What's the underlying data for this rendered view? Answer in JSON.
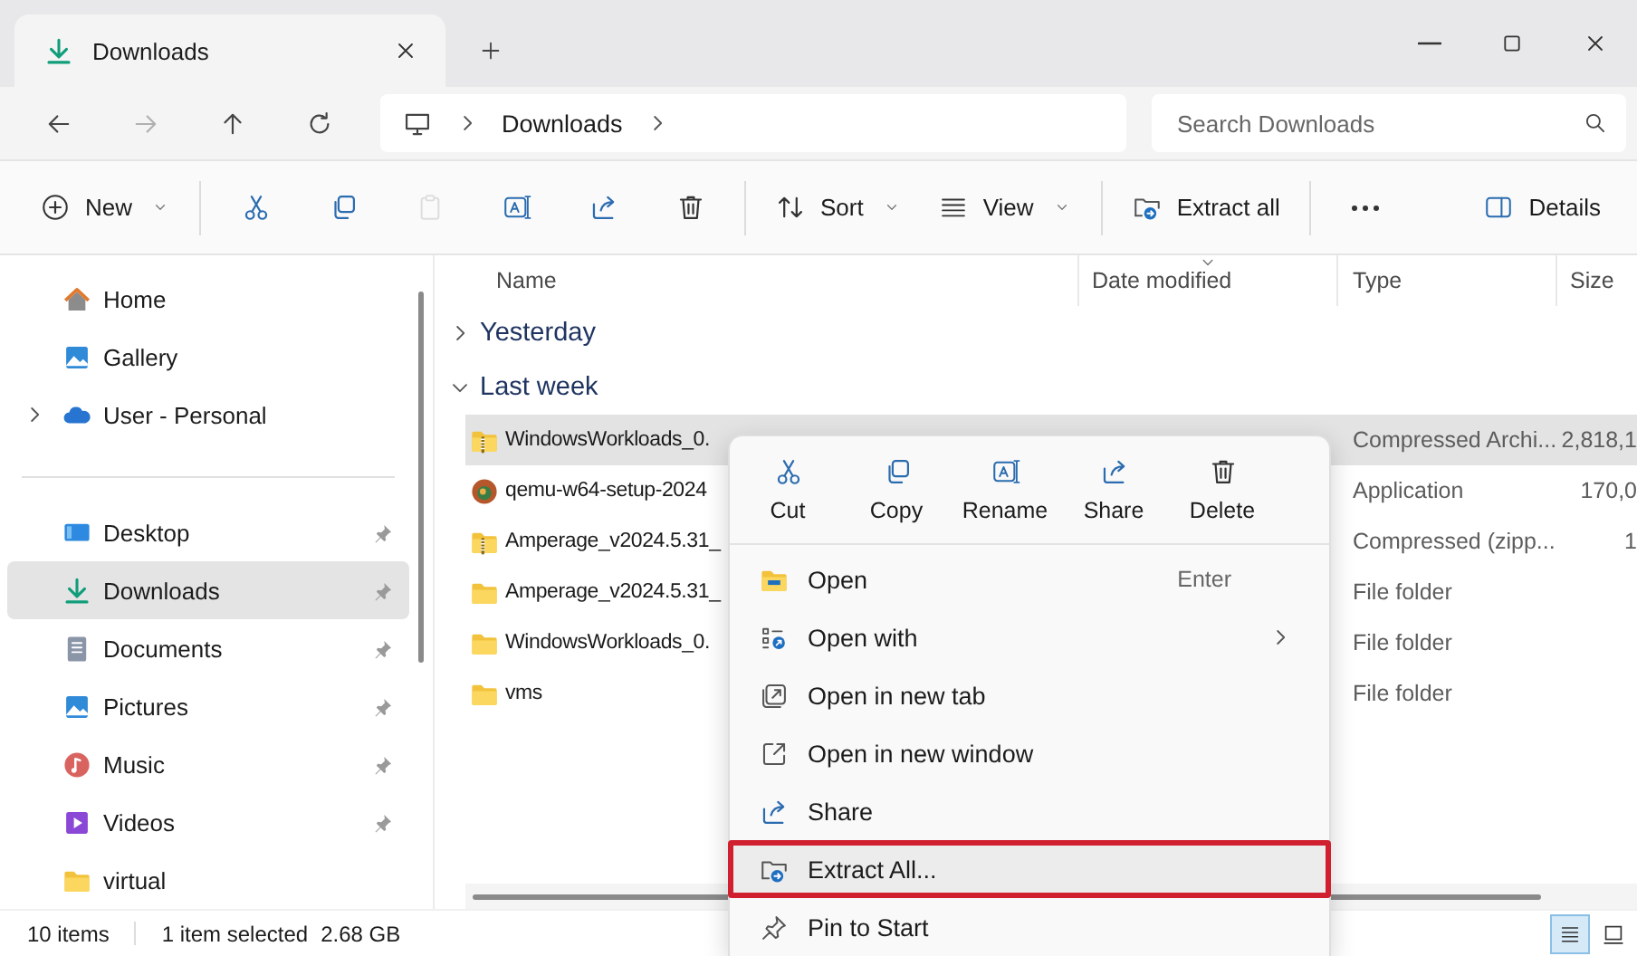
{
  "window": {
    "tab_title": "Downloads"
  },
  "address": {
    "breadcrumbs": [
      "Downloads"
    ]
  },
  "search": {
    "placeholder": "Search Downloads"
  },
  "toolbar": {
    "items": [
      {
        "kind": "menu",
        "label": "New",
        "disabled": false
      },
      {
        "kind": "separator"
      },
      {
        "kind": "icon",
        "disabled": false
      },
      {
        "kind": "icon",
        "disabled": false
      },
      {
        "kind": "icon",
        "disabled": true
      },
      {
        "kind": "icon",
        "disabled": false
      },
      {
        "kind": "icon",
        "disabled": false
      },
      {
        "kind": "icon",
        "disabled": false
      },
      {
        "kind": "separator"
      },
      {
        "kind": "menu",
        "label": "Sort",
        "disabled": false
      },
      {
        "kind": "menu",
        "label": "View",
        "disabled": false
      },
      {
        "kind": "separator"
      },
      {
        "kind": "button",
        "label": "Extract all",
        "disabled": false
      },
      {
        "kind": "separator"
      },
      {
        "kind": "icon",
        "disabled": false
      }
    ],
    "details": "Details"
  },
  "sidebar": {
    "sections": [
      {
        "items": [
          {
            "label": "Home",
            "selected": false,
            "pinned": false
          },
          {
            "label": "Gallery",
            "selected": false,
            "pinned": false
          },
          {
            "label": "User - Personal",
            "selected": false,
            "pinned": false,
            "expanded": false
          }
        ]
      },
      {
        "items": [
          {
            "label": "Desktop",
            "selected": false,
            "pinned": true
          },
          {
            "label": "Downloads",
            "selected": true,
            "pinned": true
          },
          {
            "label": "Documents",
            "selected": false,
            "pinned": true
          },
          {
            "label": "Pictures",
            "selected": false,
            "pinned": true
          },
          {
            "label": "Music",
            "selected": false,
            "pinned": true
          },
          {
            "label": "Videos",
            "selected": false,
            "pinned": true
          },
          {
            "label": "virtual",
            "selected": false,
            "pinned": false
          }
        ]
      }
    ]
  },
  "file_list": {
    "columns": [
      {
        "label": "Name",
        "sorted": false
      },
      {
        "label": "Date modified",
        "sorted": true
      },
      {
        "label": "Type",
        "sorted": false
      },
      {
        "label": "Size",
        "sorted": false
      }
    ],
    "groups": [
      {
        "label": "Yesterday",
        "expanded": false
      },
      {
        "label": "Last week",
        "expanded": true,
        "rows": [
          {
            "kind": "zip",
            "name": "WindowsWorkloads_0.",
            "type": "Compressed Archi...",
            "size": "2,818,1",
            "selected": true
          },
          {
            "kind": "app",
            "name": "qemu-w64-setup-2024",
            "type": "Application",
            "size": "170,0",
            "selected": false
          },
          {
            "kind": "zip",
            "name": "Amperage_v2024.5.31_",
            "type": "Compressed (zipp...",
            "size": "1",
            "selected": false
          },
          {
            "kind": "folder",
            "name": "Amperage_v2024.5.31_",
            "type": "File folder",
            "selected": false
          },
          {
            "kind": "folder",
            "name": "WindowsWorkloads_0.",
            "type": "File folder",
            "selected": false
          },
          {
            "kind": "folder",
            "name": "vms",
            "type": "File folder",
            "selected": false
          }
        ]
      }
    ]
  },
  "context_menu": {
    "actions": [
      {
        "label": "Cut"
      },
      {
        "label": "Copy"
      },
      {
        "label": "Rename"
      },
      {
        "label": "Share"
      },
      {
        "label": "Delete"
      }
    ],
    "items": [
      {
        "label": "Open",
        "shortcut": "Enter",
        "submenu": false,
        "selected": false
      },
      {
        "label": "Open with",
        "submenu": true,
        "selected": false
      },
      {
        "label": "Open in new tab",
        "submenu": false,
        "selected": false
      },
      {
        "label": "Open in new window",
        "submenu": false,
        "selected": false
      },
      {
        "label": "Share",
        "submenu": false,
        "selected": false
      },
      {
        "label": "Extract All...",
        "submenu": false,
        "selected": true
      },
      {
        "label": "Pin to Start",
        "submenu": false,
        "selected": false
      }
    ]
  },
  "status_bar": {
    "item_count": "10 items",
    "selection": "1 item selected",
    "selection_size": "2.68 GB",
    "views": [
      {
        "selected": true
      },
      {
        "selected": false
      }
    ]
  }
}
